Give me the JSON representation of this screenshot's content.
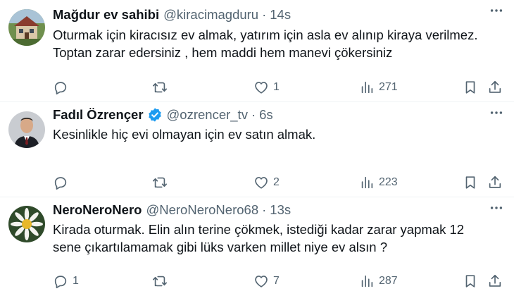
{
  "tweets": [
    {
      "name": "Mağdur ev sahibi",
      "verified": false,
      "handle": "@kiracimagduru",
      "time": "14s",
      "text": "Oturmak için kiracısız ev almak, yatırım için asla ev alınıp kiraya verilmez.\nToptan zarar edersiniz , hem maddi hem manevi çökersiniz",
      "replies": "",
      "retweets": "",
      "likes": "1",
      "views": "271"
    },
    {
      "name": "Fadıl Özrençer",
      "verified": true,
      "handle": "@ozrencer_tv",
      "time": "6s",
      "text": "Kesinlikle hiç evi olmayan için ev satın almak.",
      "replies": "",
      "retweets": "",
      "likes": "2",
      "views": "223"
    },
    {
      "name": "NeroNeroNero",
      "verified": false,
      "handle": "@NeroNeroNero68",
      "time": "13s",
      "text": "Kirada oturmak. Elin alın terine çökmek, istediği kadar zarar yapmak 12\nsene çıkartılamamak gibi lüks varken millet niye ev alsın ?",
      "replies": "1",
      "retweets": "",
      "likes": "7",
      "views": "287"
    }
  ],
  "colors": {
    "text": "#0f1419",
    "secondary": "#536471",
    "verified": "#1d9bf0",
    "divider": "#eff3f4"
  },
  "icons": [
    "reply-icon",
    "retweet-icon",
    "like-icon",
    "views-icon",
    "bookmark-icon",
    "share-icon",
    "more-icon",
    "verified-badge-icon"
  ]
}
